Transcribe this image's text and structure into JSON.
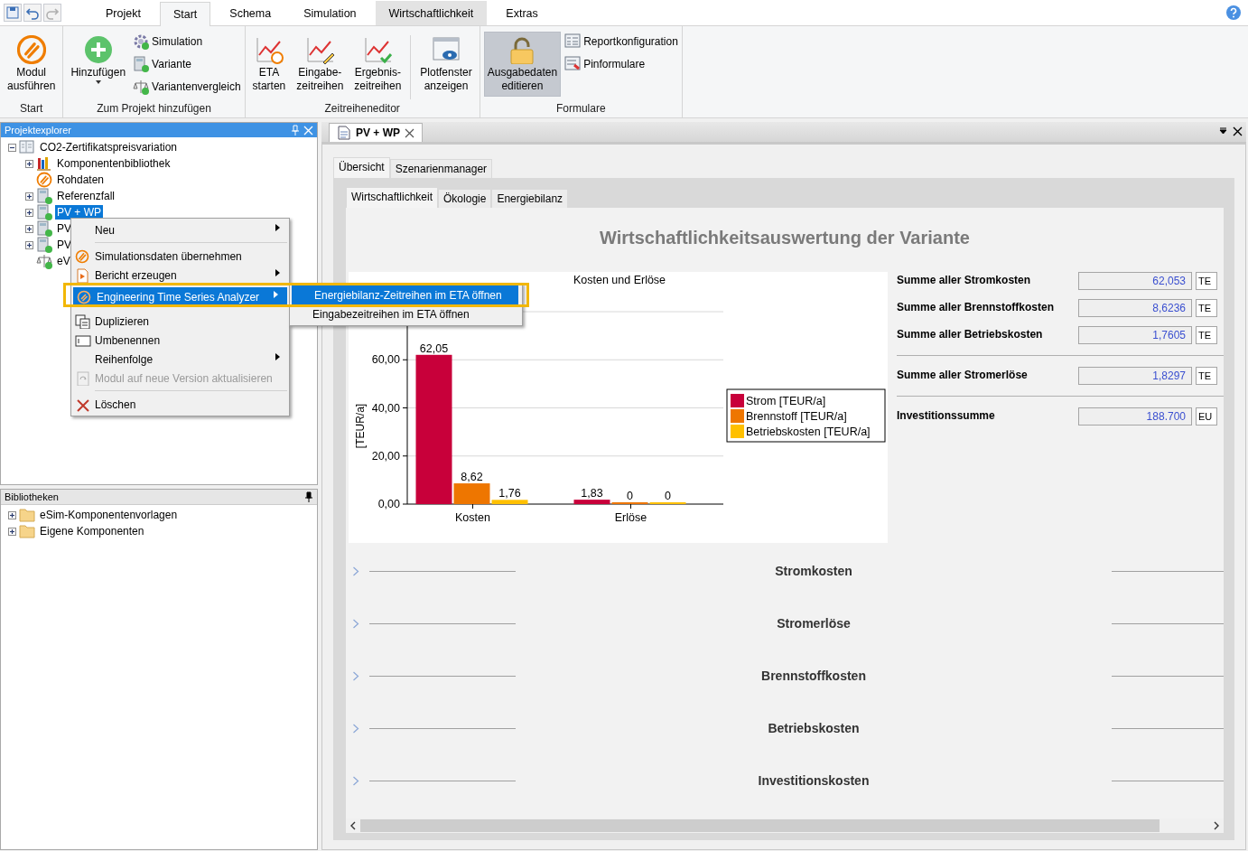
{
  "quick_access": [
    {
      "kind": "save",
      "disabled": false
    },
    {
      "kind": "undo",
      "disabled": false
    },
    {
      "kind": "redo",
      "disabled": true
    }
  ],
  "ribbon_tabs": [
    {
      "label": "Projekt",
      "selected": false,
      "contextual": false
    },
    {
      "label": "Start",
      "selected": true,
      "contextual": false
    },
    {
      "label": "Schema",
      "selected": false,
      "contextual": false
    },
    {
      "label": "Simulation",
      "selected": false,
      "contextual": false
    },
    {
      "label": "Wirtschaftlichkeit",
      "selected": false,
      "contextual": true
    },
    {
      "label": "Extras",
      "selected": false,
      "contextual": false
    }
  ],
  "ribbon_groups": [
    {
      "label": "Start",
      "large": [
        {
          "label": "Modul\nausführen",
          "pressed": false,
          "dropdown": false
        }
      ]
    },
    {
      "label": "Zum Projekt hinzufügen",
      "large": [
        {
          "label": "Hinzufügen",
          "pressed": false,
          "dropdown": true
        }
      ],
      "small": [
        {
          "label": "Simulation"
        },
        {
          "label": "Variante"
        },
        {
          "label": "Variantenvergleich"
        }
      ]
    },
    {
      "label": "Zeitreiheneditor",
      "large": [
        {
          "label": "ETA\nstarten",
          "pressed": false,
          "dropdown": false
        },
        {
          "label": "Eingabe-\nzeitreihen",
          "pressed": false,
          "dropdown": false
        },
        {
          "label": "Ergebnis-\nzeitreihen",
          "pressed": false,
          "dropdown": false
        },
        {
          "label": "Plotfenster\nanzeigen",
          "pressed": false,
          "dropdown": false
        }
      ]
    },
    {
      "label": "Formulare",
      "large": [
        {
          "label": "Ausgabedaten\neditieren",
          "pressed": true,
          "dropdown": false
        }
      ],
      "small": [
        {
          "label": "Reportkonfiguration"
        },
        {
          "label": "Pinformulare"
        }
      ]
    }
  ],
  "project_explorer": {
    "title": "Projektexplorer",
    "tree": [
      {
        "label": "CO2-Zertifikatspreisvariation",
        "collapsible": true,
        "expanded": true,
        "selected": false,
        "children": [
          {
            "label": "Komponentenbibliothek",
            "collapsible": true,
            "expanded": false,
            "selected": false
          },
          {
            "label": "Rohdaten",
            "collapsible": false,
            "selected": false
          },
          {
            "label": "Referenzfall",
            "collapsible": true,
            "expanded": false,
            "selected": false
          },
          {
            "label": "PV + WP",
            "collapsible": true,
            "expanded": false,
            "selected": true
          },
          {
            "label": "PV",
            "collapsible": true,
            "expanded": false,
            "selected": false
          },
          {
            "label": "PV",
            "collapsible": true,
            "expanded": false,
            "selected": false
          },
          {
            "label": "eV",
            "collapsible": false,
            "selected": false
          }
        ]
      }
    ]
  },
  "libraries": {
    "title": "Bibliotheken",
    "tree": [
      {
        "label": "eSim-Komponentenvorlagen",
        "collapsible": true,
        "expanded": false,
        "selected": false
      },
      {
        "label": "Eigene Komponenten",
        "collapsible": true,
        "expanded": false,
        "selected": false
      }
    ]
  },
  "context_menu": [
    {
      "label": "Neu",
      "submenu": true,
      "selected": false,
      "disabled": false,
      "separator_before": false
    },
    {
      "label": "Simulationsdaten übernehmen",
      "submenu": false,
      "selected": false,
      "disabled": false,
      "separator_before": true
    },
    {
      "label": "Bericht erzeugen",
      "submenu": true,
      "selected": false,
      "disabled": false,
      "separator_before": false
    },
    {
      "label": "Engineering Time Series Analyzer",
      "submenu": true,
      "selected": true,
      "disabled": false,
      "separator_before": false
    },
    {
      "label": "Duplizieren",
      "submenu": false,
      "selected": false,
      "disabled": false,
      "separator_before": false
    },
    {
      "label": "Umbenennen",
      "submenu": false,
      "selected": false,
      "disabled": false,
      "separator_before": false
    },
    {
      "label": "Reihenfolge",
      "submenu": true,
      "selected": false,
      "disabled": false,
      "separator_before": false
    },
    {
      "label": "Modul auf neue Version aktualisieren",
      "submenu": false,
      "selected": false,
      "disabled": true,
      "separator_before": false
    },
    {
      "label": "Löschen",
      "submenu": false,
      "selected": false,
      "disabled": false,
      "separator_before": true
    }
  ],
  "submenu": [
    {
      "label": "Energiebilanz-Zeitreihen im ETA öffnen",
      "selected": true
    },
    {
      "label": "Eingabezeitreihen im ETA öffnen",
      "selected": false
    }
  ],
  "document_tab": {
    "title": "PV + WP"
  },
  "view_tabs": [
    {
      "label": "Übersicht",
      "selected": true
    },
    {
      "label": "Szenarienmanager",
      "selected": false
    }
  ],
  "report_tabs": [
    {
      "label": "Wirtschaftlichkeit",
      "selected": true
    },
    {
      "label": "Ökologie",
      "selected": false
    },
    {
      "label": "Energiebilanz",
      "selected": false
    }
  ],
  "report": {
    "heading": "Wirtschaftlichkeitsauswertung der Variante",
    "chart_data": {
      "type": "bar",
      "title": "Kosten und Erlöse",
      "ylabel": "[TEUR/a]",
      "categories": [
        "Kosten",
        "Erlöse"
      ],
      "series": [
        {
          "name": "Strom [TEUR/a]",
          "color": "#c8003a",
          "values": [
            62.05,
            1.83
          ]
        },
        {
          "name": "Brennstoff [TEUR/a]",
          "color": "#ee7600",
          "values": [
            8.62,
            0
          ]
        },
        {
          "name": "Betriebskosten [TEUR/a]",
          "color": "#ffc000",
          "values": [
            1.76,
            0
          ]
        }
      ],
      "ylim": [
        0,
        80
      ],
      "yticks": [
        {
          "value": 0,
          "label": "0,00"
        },
        {
          "value": 20,
          "label": "20,00"
        },
        {
          "value": 40,
          "label": "40,00"
        },
        {
          "value": 60,
          "label": "60,00"
        }
      ],
      "grid": true,
      "legend": "right",
      "value_labels": [
        [
          "62,05",
          "1,83"
        ],
        [
          "8,62",
          "0"
        ],
        [
          "1,76",
          "0"
        ]
      ]
    },
    "summary": [
      {
        "label": "Summe aller Stromkosten",
        "value": "62,053",
        "unit": "TE",
        "separator_before": false
      },
      {
        "label": "Summe aller Brennstoffkosten",
        "value": "8,6236",
        "unit": "TE",
        "separator_before": false
      },
      {
        "label": "Summe aller Betriebskosten",
        "value": "1,7605",
        "unit": "TE",
        "separator_before": false
      },
      {
        "label": "Summe aller Stromerlöse",
        "value": "1,8297",
        "unit": "TE",
        "separator_before": true
      },
      {
        "label": "Investitionssumme",
        "value": "188.700",
        "unit": "EU",
        "separator_before": true
      }
    ],
    "sections": [
      {
        "title": "Stromkosten",
        "expanded": false
      },
      {
        "title": "Stromerlöse",
        "expanded": false
      },
      {
        "title": "Brennstoffkosten",
        "expanded": false
      },
      {
        "title": "Betriebskosten",
        "expanded": false
      },
      {
        "title": "Investitionskosten",
        "expanded": false
      }
    ]
  }
}
